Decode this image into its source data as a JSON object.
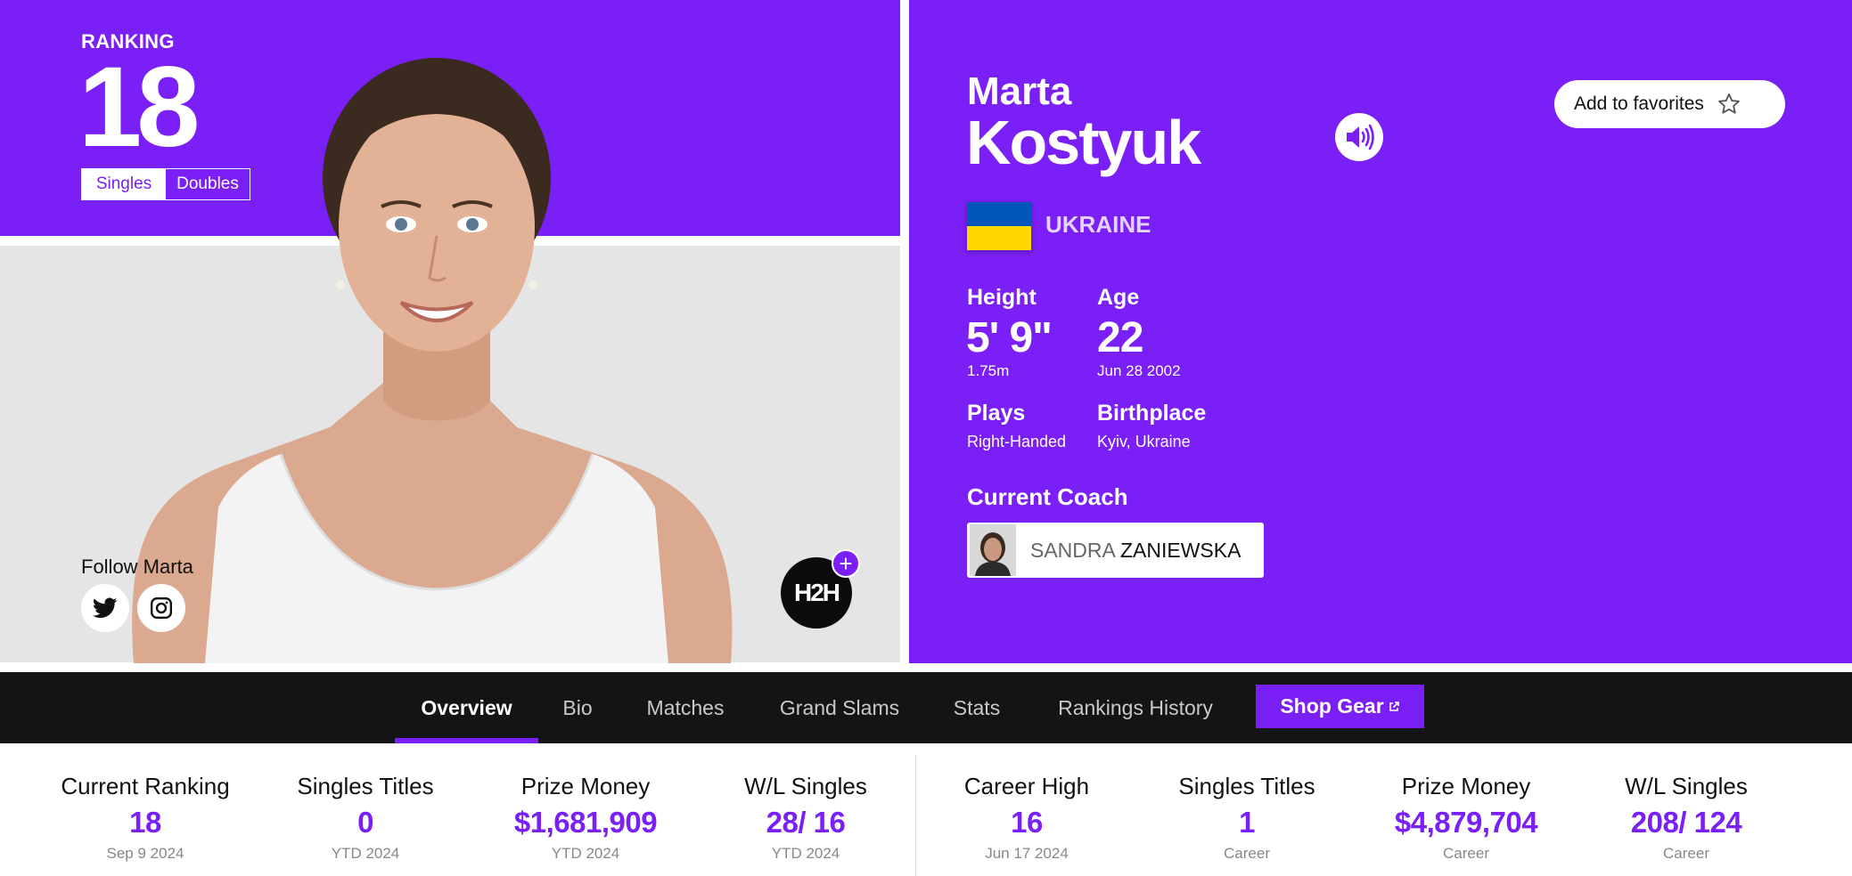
{
  "ranking": {
    "label": "RANKING",
    "value": "18",
    "toggle": [
      "Singles",
      "Doubles"
    ],
    "selected": "Singles"
  },
  "social": {
    "follow_label": "Follow Marta",
    "icons": [
      "twitter-icon",
      "instagram-icon"
    ]
  },
  "h2h": {
    "label": "H2H",
    "plus": "+"
  },
  "player": {
    "first_name": "Marta",
    "last_name": "Kostyuk",
    "country": "UKRAINE",
    "flag_colors": [
      "#0057b7",
      "#ffd700"
    ]
  },
  "favorites": {
    "label": "Add to favorites",
    "icon": "star-icon"
  },
  "attributes": {
    "height": {
      "label": "Height",
      "value": "5' 9\"",
      "sub": "1.75m"
    },
    "age": {
      "label": "Age",
      "value": "22",
      "sub": "Jun 28 2002"
    },
    "plays": {
      "label": "Plays",
      "value": "Right-Handed"
    },
    "birthplace": {
      "label": "Birthplace",
      "value": "Kyiv, Ukraine"
    }
  },
  "coach": {
    "label": "Current Coach",
    "first": "SANDRA",
    "last": "ZANIEWSKA"
  },
  "nav": {
    "tabs": [
      "Overview",
      "Bio",
      "Matches",
      "Grand Slams",
      "Stats",
      "Rankings History"
    ],
    "active": "Overview",
    "shop_label": "Shop Gear"
  },
  "stats": [
    {
      "label": "Current Ranking",
      "value": "18",
      "sub": "Sep 9 2024"
    },
    {
      "label": "Singles Titles",
      "value": "0",
      "sub": "YTD 2024"
    },
    {
      "label": "Prize Money",
      "value": "$1,681,909",
      "sub": "YTD 2024"
    },
    {
      "label": "W/L Singles",
      "value": "28/ 16",
      "sub": "YTD 2024"
    },
    {
      "label": "Career High",
      "value": "16",
      "sub": "Jun 17 2024"
    },
    {
      "label": "Singles Titles",
      "value": "1",
      "sub": "Career"
    },
    {
      "label": "Prize Money",
      "value": "$4,879,704",
      "sub": "Career"
    },
    {
      "label": "W/L Singles",
      "value": "208/ 124",
      "sub": "Career"
    }
  ],
  "colors": {
    "accent": "#7a1ff5",
    "nav_bg": "#141414",
    "photo_bg": "#e5e5e5"
  }
}
